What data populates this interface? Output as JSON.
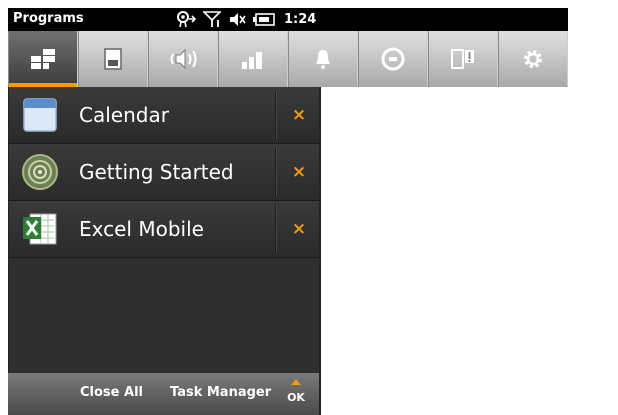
{
  "statusbar": {
    "title": "Programs",
    "time": "1:24",
    "icons": [
      "connectivity-icon",
      "signal-icon",
      "volume-muted-icon",
      "battery-icon"
    ]
  },
  "tabs": [
    {
      "name": "tab-programs",
      "icon": "programs-icon",
      "active": true
    },
    {
      "name": "tab-memory",
      "icon": "memory-icon",
      "active": false
    },
    {
      "name": "tab-sound",
      "icon": "sound-icon",
      "active": false
    },
    {
      "name": "tab-signal",
      "icon": "signal-bars-icon",
      "active": false
    },
    {
      "name": "tab-notifications",
      "icon": "bell-icon",
      "active": false
    },
    {
      "name": "tab-clock",
      "icon": "clock-icon",
      "active": false
    },
    {
      "name": "tab-device-alert",
      "icon": "device-alert-icon",
      "active": false
    },
    {
      "name": "tab-settings",
      "icon": "gear-icon",
      "active": false
    }
  ],
  "programs": [
    {
      "label": "Calendar",
      "icon": "calendar-icon"
    },
    {
      "label": "Getting Started",
      "icon": "getting-started-icon"
    },
    {
      "label": "Excel Mobile",
      "icon": "excel-icon"
    }
  ],
  "close_glyph": "×",
  "bottombar": {
    "close_all": "Close All",
    "task_manager": "Task Manager",
    "ok": "OK"
  },
  "colors": {
    "accent": "#f39a14",
    "panel": "#2f2f2f",
    "statusbar": "#000000"
  }
}
